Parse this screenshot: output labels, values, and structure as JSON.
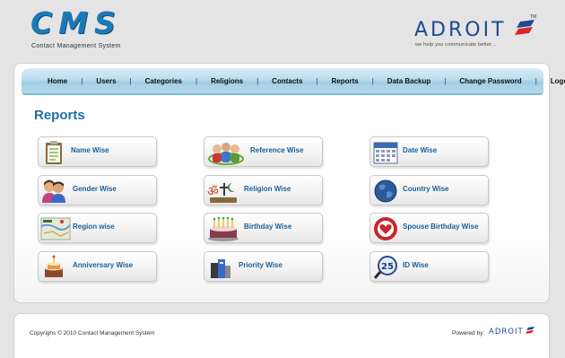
{
  "header": {
    "logo": "CMS",
    "tagline": "Contact Management System",
    "brand": "ADROIT",
    "brand_tm": "TM",
    "brand_tagline": "we help you communicate better..."
  },
  "nav": {
    "items": [
      {
        "label": "Home",
        "name": "nav-home"
      },
      {
        "label": "Users",
        "name": "nav-users"
      },
      {
        "label": "Categories",
        "name": "nav-categories"
      },
      {
        "label": "Religions",
        "name": "nav-religions"
      },
      {
        "label": "Contacts",
        "name": "nav-contacts"
      },
      {
        "label": "Reports",
        "name": "nav-reports"
      },
      {
        "label": "Data Backup",
        "name": "nav-data-backup"
      },
      {
        "label": "Change Password",
        "name": "nav-change-password"
      },
      {
        "label": "Logout",
        "name": "nav-logout"
      }
    ],
    "separator": "|"
  },
  "main": {
    "title": "Reports",
    "tiles": [
      {
        "label": "Name Wise",
        "icon": "clipboard-icon"
      },
      {
        "label": "Reference Wise",
        "icon": "people-group-icon"
      },
      {
        "label": "Date Wise",
        "icon": "calendar-icon"
      },
      {
        "label": "Gender Wise",
        "icon": "male-female-icon"
      },
      {
        "label": "Religion Wise",
        "icon": "religion-symbols-icon"
      },
      {
        "label": "Country Wise",
        "icon": "globe-icon"
      },
      {
        "label": "Region wise",
        "icon": "map-icon"
      },
      {
        "label": "Birthday Wise",
        "icon": "birthday-cake-icon"
      },
      {
        "label": "Spouse Birthday Wise",
        "icon": "heart-couple-icon"
      },
      {
        "label": "Anniversary Wise",
        "icon": "anniversary-cake-icon"
      },
      {
        "label": "Priority Wise",
        "icon": "priority-books-icon"
      },
      {
        "label": "ID Wise",
        "icon": "id-magnifier-icon"
      }
    ]
  },
  "footer": {
    "copyright": "Copyrighs © 2010 Contact Management System",
    "powered_by": "Powered by:",
    "brand": "ADROIT"
  },
  "colors": {
    "accent_blue": "#1f6fa8",
    "brand_navy": "#1d4a91",
    "brand_red": "#d8252c",
    "nav_blue": "#9fcde4"
  }
}
